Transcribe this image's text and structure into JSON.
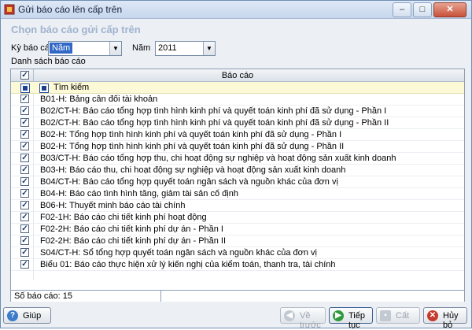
{
  "window": {
    "title": "Gửi báo cáo lên cấp trên"
  },
  "heading": "Chọn báo cáo gửi cấp trên",
  "filters": {
    "ky_label": "Kỳ báo cáo",
    "ky_value": "Năm",
    "nam_label": "Năm",
    "nam_value": "2011"
  },
  "list_label": "Danh sách báo cáo",
  "grid": {
    "column_header": "Báo cáo",
    "search_label": "Tìm kiếm",
    "rows": [
      "B01-H: Bảng cân đối tài khoản",
      "B02/CT-H: Báo cáo tổng hợp tình hình kinh phí và quyết toán kinh phí đã sử dụng - Phần I",
      "B02/CT-H: Báo cáo tổng hợp tình hình kinh phí và quyết toán kinh phí đã sử dụng - Phần II",
      "B02-H: Tổng hợp tình hình kinh phí và quyết toán kinh phí đã sử dụng - Phần I",
      "B02-H: Tổng hợp tình hình kinh phí và quyết toán kinh phí đã sử dụng - Phần II",
      "B03/CT-H: Báo cáo tổng hợp thu, chi hoạt động sự nghiệp và hoạt động sản xuất kinh doanh",
      "B03-H: Báo cáo thu, chi hoạt động sự nghiệp và hoạt động sản xuất kinh doanh",
      "B04/CT-H: Báo cáo tổng hợp quyết toán ngân sách và nguồn khác của đơn vị",
      "B04-H: Báo cáo tình hình tăng, giảm tài sản cố định",
      "B06-H: Thuyết minh báo cáo tài chính",
      "F02-1H: Báo cáo chi tiết kinh phí hoạt động",
      "F02-2H: Báo cáo chi tiết kinh phí dự án - Phần I",
      "F02-2H: Báo cáo chi tiết kinh phí dự án - Phần II",
      "S04/CT-H: Sổ tổng hợp quyết toán ngân sách và nguồn khác của đơn vị",
      "Biểu 01: Báo cáo thực hiện xử lý kiến nghị của kiểm toán, thanh tra, tài chính"
    ],
    "count_text": "Số báo cáo: 15"
  },
  "buttons": {
    "help": "Giúp",
    "back": "Về trước",
    "next": "Tiếp tục",
    "save": "Cất",
    "cancel": "Hủy bỏ"
  },
  "colors": {
    "heading": "#9fb3cf",
    "search_row": "#fcf9d6",
    "selection": "#3168c6"
  }
}
